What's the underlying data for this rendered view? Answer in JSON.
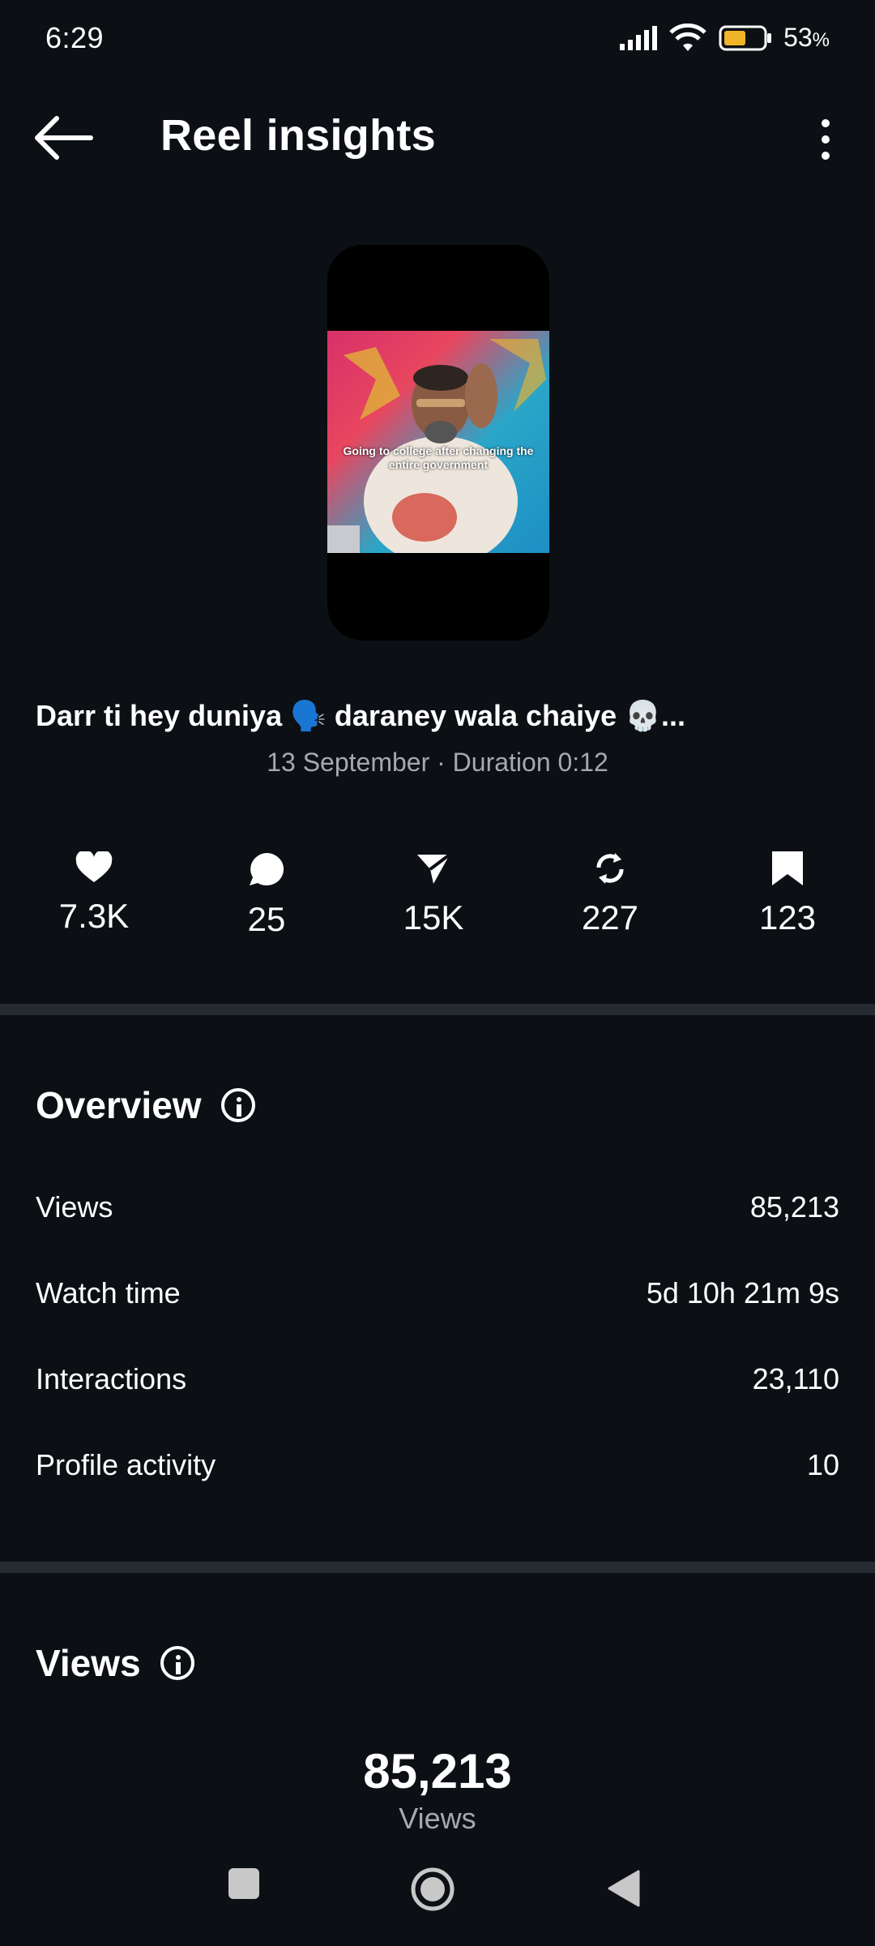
{
  "status_bar": {
    "time": "6:29",
    "battery": "53",
    "battery_unit": "%"
  },
  "header": {
    "title": "Reel insights"
  },
  "reel": {
    "thumbnail_caption": "Going to college after changing the entire government",
    "title": "Darr ti hey duniya 🗣️ daraney wala chaiye 💀...",
    "meta": "13 September · Duration 0:12"
  },
  "stats": {
    "likes": "7.3K",
    "comments": "25",
    "shares": "15K",
    "reposts": "227",
    "saves": "123"
  },
  "overview": {
    "title": "Overview",
    "rows": [
      {
        "label": "Views",
        "value": "85,213"
      },
      {
        "label": "Watch time",
        "value": "5d 10h 21m 9s"
      },
      {
        "label": "Interactions",
        "value": "23,110"
      },
      {
        "label": "Profile activity",
        "value": "10"
      }
    ]
  },
  "views_section": {
    "title": "Views",
    "number": "85,213",
    "label": "Views"
  },
  "colors": {
    "background": "#0c0f14",
    "divider": "#262a31",
    "secondary_text": "#a5a9b0",
    "battery_fill": "#f0b429"
  }
}
